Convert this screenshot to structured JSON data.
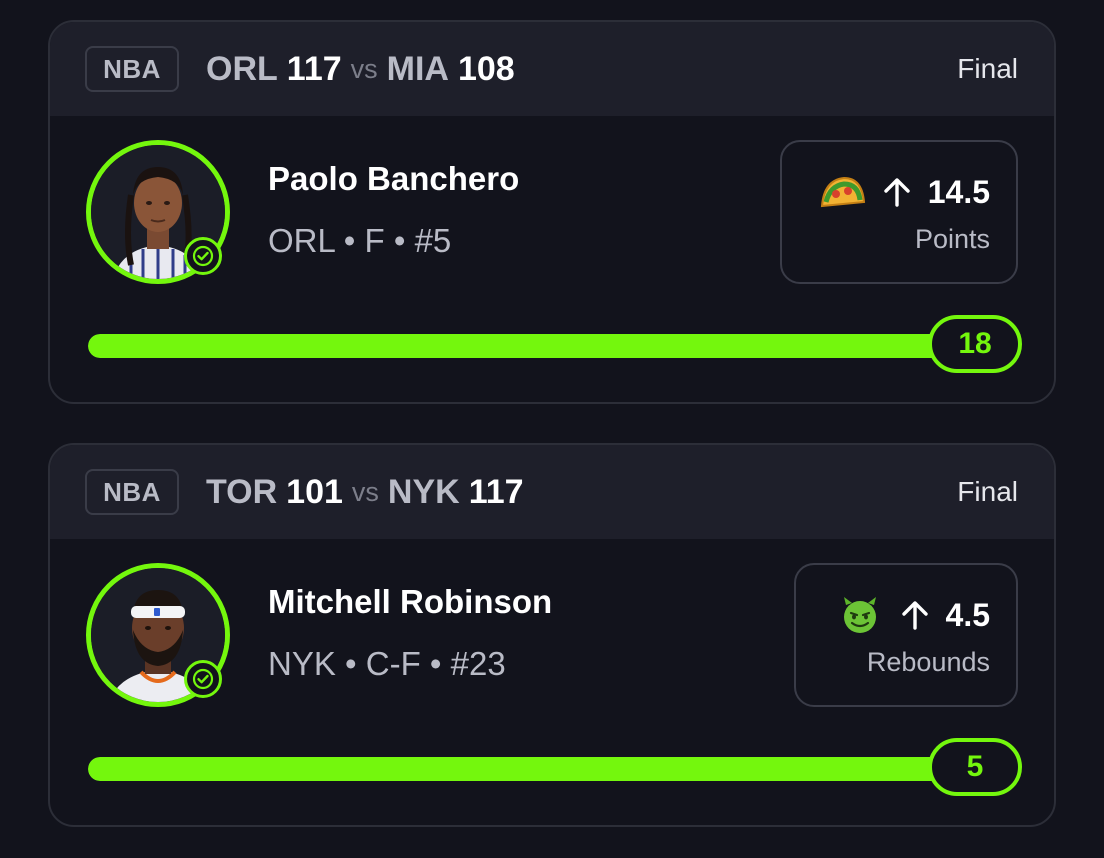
{
  "colors": {
    "accent": "#74f70d",
    "background": "#12131c",
    "header_bg": "#1e1f2a"
  },
  "cards": [
    {
      "league": "NBA",
      "away_team": "ORL",
      "away_score": "117",
      "vs": "vs",
      "home_team": "MIA",
      "home_score": "108",
      "status": "Final",
      "player_name": "Paolo Banchero",
      "player_meta": "ORL • F • #5",
      "pick_icon": "taco-emoji",
      "pick_direction": "over",
      "pick_line": "14.5",
      "pick_stat": "Points",
      "result": "18",
      "progress": 1.0
    },
    {
      "league": "NBA",
      "away_team": "TOR",
      "away_score": "101",
      "vs": "vs",
      "home_team": "NYK",
      "home_score": "117",
      "status": "Final",
      "player_name": "Mitchell Robinson",
      "player_meta": "NYK • C-F • #23",
      "pick_icon": "green-devil-emoji",
      "pick_direction": "over",
      "pick_line": "4.5",
      "pick_stat": "Rebounds",
      "result": "5",
      "progress": 1.0
    }
  ]
}
